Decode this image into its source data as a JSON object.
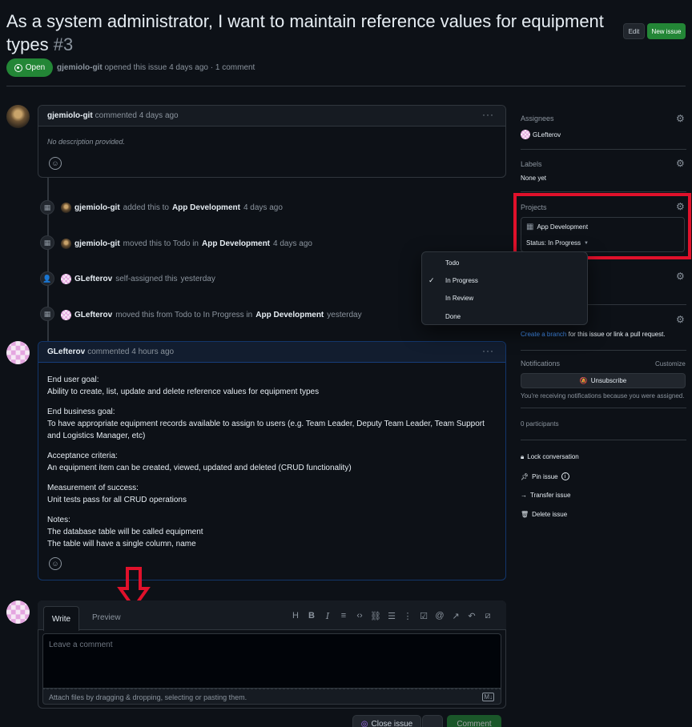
{
  "header": {
    "title": "As a system administrator, I want to maintain reference values for equipment types",
    "number": "#3",
    "edit_label": "Edit",
    "new_issue_label": "New issue",
    "status": "Open",
    "author": "gjemiolo-git",
    "meta": "opened this issue 4 days ago · 1 comment"
  },
  "first_comment": {
    "author": "gjemiolo-git",
    "time": "commented 4 days ago",
    "body": "No description provided."
  },
  "timeline": [
    {
      "actor": "gjemiolo-git",
      "pre": "added this to",
      "target": "App Development",
      "post": "",
      "time": "4 days ago"
    },
    {
      "actor": "gjemiolo-git",
      "pre": "moved this to Todo in",
      "target": "App Development",
      "post": "",
      "time": "4 days ago"
    },
    {
      "actor": "GLefterov",
      "pre": "self-assigned this",
      "target": "",
      "post": "",
      "time": "yesterday"
    },
    {
      "actor": "GLefterov",
      "pre": "moved this from Todo to In Progress in",
      "target": "App Development",
      "post": "",
      "time": "yesterday"
    }
  ],
  "second_comment": {
    "author": "GLefterov",
    "time": "commented 4 hours ago",
    "sections": [
      {
        "heading": "End user goal:",
        "lines": [
          "Ability to create, list, update and delete reference values for equipment types"
        ]
      },
      {
        "heading": "End business goal:",
        "lines": [
          "To have appropriate equipment records available to assign to users (e.g. Team Leader, Deputy Team Leader, Team Support and Logistics Manager, etc)"
        ]
      },
      {
        "heading": "Acceptance criteria:",
        "lines": [
          "An equipment item can be created, viewed, updated and deleted (CRUD functionality)"
        ]
      },
      {
        "heading": "Measurement of success:",
        "lines": [
          "Unit tests pass for all CRUD operations"
        ]
      },
      {
        "heading": "Notes:",
        "lines": [
          "The database table will be called equipment",
          "The table will have a single column, name"
        ]
      }
    ]
  },
  "composer": {
    "write_tab": "Write",
    "preview_tab": "Preview",
    "placeholder": "Leave a comment",
    "attach_text": "Attach files by dragging & dropping, selecting or pasting them.",
    "close_issue_label": "Close issue",
    "comment_label": "Comment"
  },
  "sidebar": {
    "assignees_label": "Assignees",
    "assignee": "GLefterov",
    "labels_label": "Labels",
    "labels_value": "None yet",
    "projects_label": "Projects",
    "project_name": "App Development",
    "project_status": "Status: In Progress",
    "create_branch_link": "Create a branch",
    "create_branch_rest": "for this issue or link a pull request.",
    "notifications_label": "Notifications",
    "customize_label": "Customize",
    "unsubscribe_label": "Unsubscribe",
    "notif_reason": "You're receiving notifications because you were assigned.",
    "participants": "0 participants",
    "lock_label": "Lock conversation",
    "pin_label": "Pin issue",
    "transfer_label": "Transfer issue",
    "delete_label": "Delete issue"
  },
  "status_dropdown": {
    "options": [
      "Todo",
      "In Progress",
      "In Review",
      "Done"
    ],
    "selected": "In Progress"
  },
  "colors": {
    "accent_green": "#238636",
    "highlight_red": "#e0112b",
    "link_blue": "#4493f8"
  }
}
